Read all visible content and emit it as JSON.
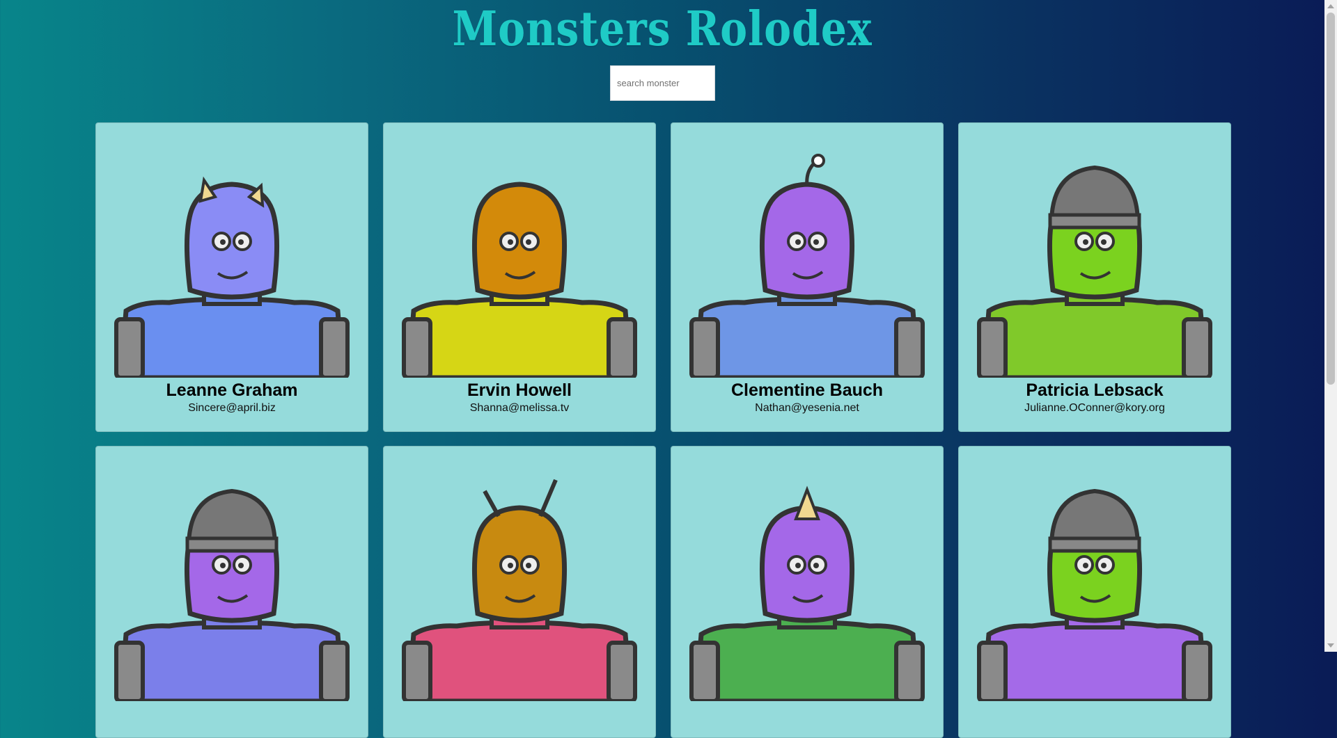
{
  "header": {
    "title": "Monsters Rolodex"
  },
  "search": {
    "placeholder": "search monster",
    "value": ""
  },
  "monsters": [
    {
      "name": "Leanne Graham",
      "email": "Sincere@april.biz",
      "head": "#8a8cf5",
      "body": "#6a8ff0",
      "feature": "horns",
      "feature_color": "#f0d890"
    },
    {
      "name": "Ervin Howell",
      "email": "Shanna@melissa.tv",
      "head": "#d38a0a",
      "body": "#d6d615",
      "feature": "hood",
      "feature_color": "#d38a0a"
    },
    {
      "name": "Clementine Bauch",
      "email": "Nathan@yesenia.net",
      "head": "#a468e8",
      "body": "#6e96e6",
      "feature": "antenna",
      "feature_color": "#555555"
    },
    {
      "name": "Patricia Lebsack",
      "email": "Julianne.OConner@kory.org",
      "head": "#7bd21f",
      "body": "#80c92a",
      "feature": "helmet",
      "feature_color": "#555555"
    },
    {
      "name": "",
      "email": "",
      "head": "#a468e8",
      "body": "#7b7fea",
      "feature": "helmet",
      "feature_color": "#666666"
    },
    {
      "name": "",
      "email": "",
      "head": "#c88a10",
      "body": "#e0527d",
      "feature": "antennae",
      "feature_color": "#555555"
    },
    {
      "name": "",
      "email": "",
      "head": "#a468e8",
      "body": "#4caf50",
      "feature": "horn",
      "feature_color": "#f0d890"
    },
    {
      "name": "",
      "email": "",
      "head": "#7bd21f",
      "body": "#a46ae8",
      "feature": "helmet",
      "feature_color": "#666666"
    }
  ],
  "icons": {
    "scroll_up": "chevron-up-icon",
    "scroll_down": "chevron-down-icon"
  },
  "colors": {
    "card_bg": "#95dbdb",
    "title": "#1fcbc6",
    "bg_start": "#08858a",
    "bg_end": "#0a1b56"
  }
}
